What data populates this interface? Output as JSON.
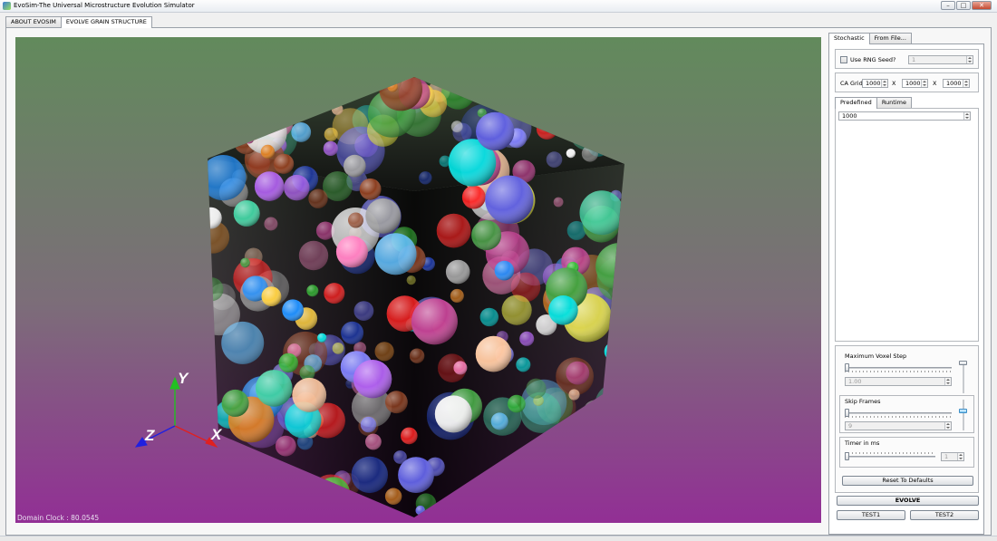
{
  "window": {
    "title": "EvoSim-The Universal Microstructure Evolution Simulator",
    "min_glyph": "–",
    "max_glyph": "□",
    "close_glyph": "✕"
  },
  "main_tabs": [
    {
      "label": "ABOUT EVOSIM",
      "active": false
    },
    {
      "label": "EVOLVE GRAIN STRUCTURE",
      "active": true
    }
  ],
  "viewport": {
    "domain_clock": "Domain Clock : 80.0545",
    "axes": {
      "x": "X",
      "y": "Y",
      "z": "Z"
    },
    "colors": {
      "x_axis": "#e02020",
      "y_axis": "#22c022",
      "z_axis": "#2020e0",
      "label": "#ffffff"
    }
  },
  "side_tabs": [
    {
      "label": "Stochastic",
      "active": true
    },
    {
      "label": "From File...",
      "active": false
    }
  ],
  "rng": {
    "label": "Use RNG Seed?",
    "checked": false,
    "seed_value": "1"
  },
  "ca_grid": {
    "label": "CA Grid",
    "x": "1000",
    "sep1": "X",
    "y": "1000",
    "sep2": "X",
    "z": "1000"
  },
  "seed_tabs": [
    {
      "label": "Predefined",
      "active": true
    },
    {
      "label": "Runtime",
      "active": false
    }
  ],
  "predefined": {
    "count": "1000"
  },
  "controls": {
    "max_voxel_step": {
      "label": "Maximum Voxel Step",
      "value": "1.00",
      "level": 0
    },
    "skip_frames": {
      "label": "Skip Frames",
      "value": "9",
      "level": 0
    },
    "timer": {
      "label": "Timer in ms",
      "value": "1",
      "level": 0
    },
    "reset_label": "Reset To Defaults"
  },
  "actions": {
    "evolve": "EVOLVE",
    "test1": "TEST1",
    "test2": "TEST2"
  }
}
